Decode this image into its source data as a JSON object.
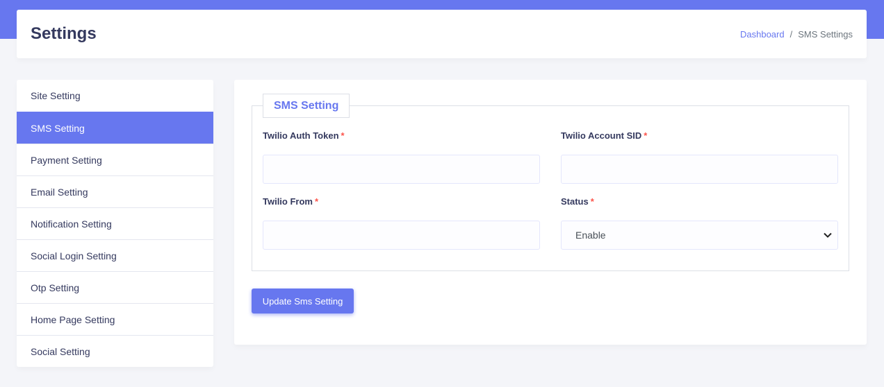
{
  "header": {
    "title": "Settings",
    "breadcrumb": {
      "link": "Dashboard",
      "separator": "/",
      "current": "SMS Settings"
    }
  },
  "sidebar": {
    "items": [
      {
        "label": "Site Setting"
      },
      {
        "label": "SMS Setting",
        "active": true
      },
      {
        "label": "Payment Setting"
      },
      {
        "label": "Email Setting"
      },
      {
        "label": "Notification Setting"
      },
      {
        "label": "Social Login Setting"
      },
      {
        "label": "Otp Setting"
      },
      {
        "label": "Home Page Setting"
      },
      {
        "label": "Social Setting"
      }
    ]
  },
  "form": {
    "legend": "SMS Setting",
    "fields": {
      "auth_token": {
        "label": "Twilio Auth Token",
        "required": "*",
        "value": ""
      },
      "account_sid": {
        "label": "Twilio Account SID",
        "required": "*",
        "value": ""
      },
      "twilio_from": {
        "label": "Twilio From",
        "required": "*",
        "value": ""
      },
      "status": {
        "label": "Status",
        "required": "*",
        "selected": "Enable"
      }
    },
    "submit_label": "Update Sms Setting"
  },
  "colors": {
    "accent": "#6777ef",
    "background": "#f4f5f9",
    "required": "#fc544b"
  }
}
